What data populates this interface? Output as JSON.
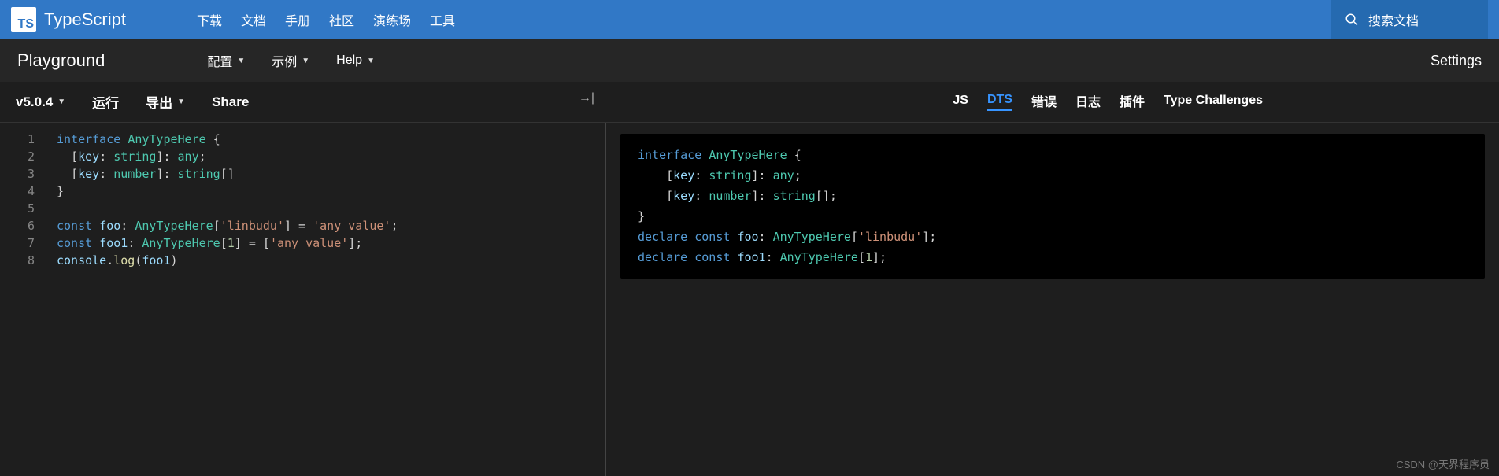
{
  "header": {
    "logo_short": "TS",
    "logo_text": "TypeScript",
    "nav": [
      "下载",
      "文档",
      "手册",
      "社区",
      "演练场",
      "工具"
    ],
    "search_placeholder": "搜索文档"
  },
  "subnav": {
    "title": "Playground",
    "items": [
      {
        "label": "配置",
        "caret": true
      },
      {
        "label": "示例",
        "caret": true
      },
      {
        "label": "Help",
        "caret": true
      }
    ],
    "settings": "Settings"
  },
  "toolbar": {
    "version": "v5.0.4",
    "run": "运行",
    "export": "导出",
    "share": "Share"
  },
  "editor": {
    "line_numbers": [
      "1",
      "2",
      "3",
      "4",
      "5",
      "6",
      "7",
      "8"
    ],
    "lines": [
      [
        [
          "kw",
          "interface"
        ],
        [
          "sp",
          " "
        ],
        [
          "type",
          "AnyTypeHere"
        ],
        [
          "sp",
          " "
        ],
        [
          "pun",
          "{"
        ]
      ],
      [
        [
          "sp",
          "  "
        ],
        [
          "pun",
          "["
        ],
        [
          "var",
          "key"
        ],
        [
          "pun",
          ": "
        ],
        [
          "type",
          "string"
        ],
        [
          "pun",
          "]: "
        ],
        [
          "type",
          "any"
        ],
        [
          "pun",
          ";"
        ]
      ],
      [
        [
          "sp",
          "  "
        ],
        [
          "pun",
          "["
        ],
        [
          "var",
          "key"
        ],
        [
          "pun",
          ": "
        ],
        [
          "type",
          "number"
        ],
        [
          "pun",
          "]: "
        ],
        [
          "type",
          "string"
        ],
        [
          "pun",
          "[]"
        ]
      ],
      [
        [
          "pun",
          "}"
        ]
      ],
      [
        [
          "sp",
          ""
        ]
      ],
      [
        [
          "kw",
          "const"
        ],
        [
          "sp",
          " "
        ],
        [
          "var",
          "foo"
        ],
        [
          "pun",
          ": "
        ],
        [
          "type",
          "AnyTypeHere"
        ],
        [
          "pun",
          "["
        ],
        [
          "str",
          "'linbudu'"
        ],
        [
          "pun",
          "] = "
        ],
        [
          "str",
          "'any value'"
        ],
        [
          "pun",
          ";"
        ]
      ],
      [
        [
          "kw",
          "const"
        ],
        [
          "sp",
          " "
        ],
        [
          "var",
          "foo1"
        ],
        [
          "pun",
          ": "
        ],
        [
          "type",
          "AnyTypeHere"
        ],
        [
          "pun",
          "["
        ],
        [
          "num",
          "1"
        ],
        [
          "pun",
          "] = ["
        ],
        [
          "str",
          "'any value'"
        ],
        [
          "pun",
          "];"
        ]
      ],
      [
        [
          "var",
          "console"
        ],
        [
          "pun",
          "."
        ],
        [
          "fn",
          "log"
        ],
        [
          "pun",
          "("
        ],
        [
          "var",
          "foo1"
        ],
        [
          "pun",
          ")"
        ]
      ]
    ]
  },
  "output_tabs": {
    "items": [
      "JS",
      "DTS",
      "错误",
      "日志",
      "插件",
      "Type Challenges"
    ],
    "active": "DTS"
  },
  "output": {
    "lines": [
      [
        [
          "kw",
          "interface"
        ],
        [
          "sp",
          " "
        ],
        [
          "type",
          "AnyTypeHere"
        ],
        [
          "sp",
          " "
        ],
        [
          "pun",
          "{"
        ]
      ],
      [
        [
          "sp",
          "    "
        ],
        [
          "pun",
          "["
        ],
        [
          "var",
          "key"
        ],
        [
          "pun",
          ": "
        ],
        [
          "type",
          "string"
        ],
        [
          "pun",
          "]: "
        ],
        [
          "type",
          "any"
        ],
        [
          "pun",
          ";"
        ]
      ],
      [
        [
          "sp",
          "    "
        ],
        [
          "pun",
          "["
        ],
        [
          "var",
          "key"
        ],
        [
          "pun",
          ": "
        ],
        [
          "type",
          "number"
        ],
        [
          "pun",
          "]: "
        ],
        [
          "type",
          "string"
        ],
        [
          "pun",
          "[];"
        ]
      ],
      [
        [
          "pun",
          "}"
        ]
      ],
      [
        [
          "kw",
          "declare"
        ],
        [
          "sp",
          " "
        ],
        [
          "kw",
          "const"
        ],
        [
          "sp",
          " "
        ],
        [
          "var",
          "foo"
        ],
        [
          "pun",
          ": "
        ],
        [
          "type",
          "AnyTypeHere"
        ],
        [
          "pun",
          "["
        ],
        [
          "str",
          "'linbudu'"
        ],
        [
          "pun",
          "];"
        ]
      ],
      [
        [
          "kw",
          "declare"
        ],
        [
          "sp",
          " "
        ],
        [
          "kw",
          "const"
        ],
        [
          "sp",
          " "
        ],
        [
          "var",
          "foo1"
        ],
        [
          "pun",
          ": "
        ],
        [
          "type",
          "AnyTypeHere"
        ],
        [
          "pun",
          "["
        ],
        [
          "num",
          "1"
        ],
        [
          "pun",
          "];"
        ]
      ]
    ]
  },
  "watermark": "CSDN @天界程序员"
}
